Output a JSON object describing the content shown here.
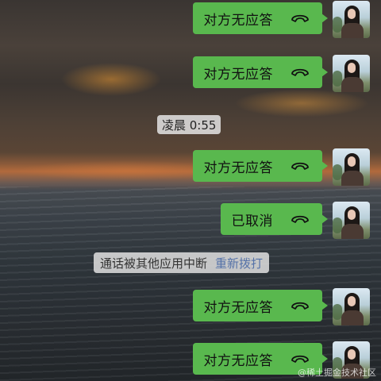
{
  "messages": [
    {
      "type": "call",
      "text": "对方无应答"
    },
    {
      "type": "call",
      "text": "对方无应答"
    },
    {
      "type": "call",
      "text": "对方无应答"
    },
    {
      "type": "call",
      "text": "已取消"
    },
    {
      "type": "call",
      "text": "对方无应答"
    },
    {
      "type": "call",
      "text": "对方无应答"
    }
  ],
  "timestamp": "凌晨 0:55",
  "system_notice": {
    "text": "通话被其他应用中断",
    "action": "重新拨打"
  },
  "watermark": "@稀土掘金技术社区",
  "colors": {
    "bubble": "#59b84e",
    "link": "#5572a8"
  }
}
